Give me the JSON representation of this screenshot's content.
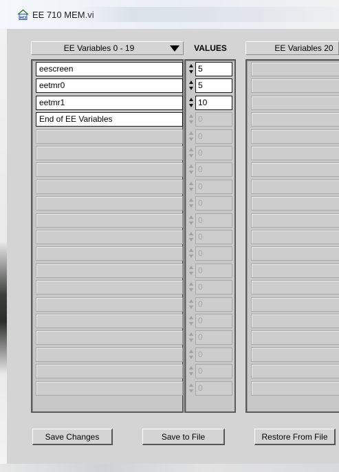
{
  "window": {
    "title": "EE 710 MEM.vi",
    "icon": "labview-vi-icon"
  },
  "columns": {
    "left_header": "EE Variables  0 - 19",
    "values_header": "VALUES",
    "right_header": "EE Variables 20"
  },
  "variables": [
    {
      "name": "eescreen",
      "value": "5",
      "active": true
    },
    {
      "name": "eetmr0",
      "value": "5",
      "active": true
    },
    {
      "name": "eetmr1",
      "value": "10",
      "active": true
    },
    {
      "name": "End of EE Variables",
      "value": "0",
      "active": false
    },
    {
      "name": "",
      "value": "0",
      "active": false
    },
    {
      "name": "",
      "value": "0",
      "active": false
    },
    {
      "name": "",
      "value": "0",
      "active": false
    },
    {
      "name": "",
      "value": "0",
      "active": false
    },
    {
      "name": "",
      "value": "0",
      "active": false
    },
    {
      "name": "",
      "value": "0",
      "active": false
    },
    {
      "name": "",
      "value": "0",
      "active": false
    },
    {
      "name": "",
      "value": "0",
      "active": false
    },
    {
      "name": "",
      "value": "0",
      "active": false
    },
    {
      "name": "",
      "value": "0",
      "active": false
    },
    {
      "name": "",
      "value": "0",
      "active": false
    },
    {
      "name": "",
      "value": "0",
      "active": false
    },
    {
      "name": "",
      "value": "0",
      "active": false
    },
    {
      "name": "",
      "value": "0",
      "active": false
    },
    {
      "name": "",
      "value": "0",
      "active": false
    },
    {
      "name": "",
      "value": "0",
      "active": false
    }
  ],
  "buttons": {
    "save_changes": "Save Changes",
    "save_to_file": "Save to File",
    "restore_from_file": "Restore From File"
  },
  "colors": {
    "panel": "#d4d4d4",
    "active_field": "#ffffff",
    "inactive_field": "#cdcdcd"
  }
}
